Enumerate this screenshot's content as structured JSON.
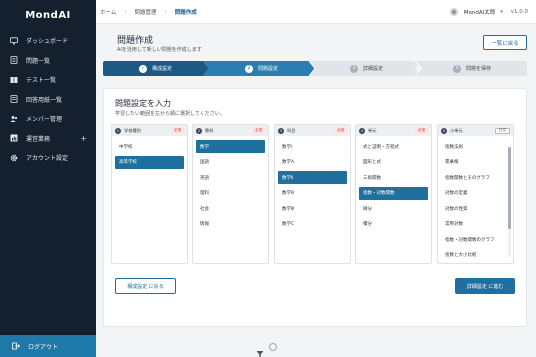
{
  "app": {
    "logo": "MondAI"
  },
  "sidebar": {
    "items": [
      {
        "label": "ダッシュボード",
        "icon": "monitor-icon"
      },
      {
        "label": "問題一覧",
        "icon": "list-icon"
      },
      {
        "label": "テスト一覧",
        "icon": "book-icon"
      },
      {
        "label": "回答用紙一覧",
        "icon": "answer-sheet-icon"
      },
      {
        "label": "メンバー管理",
        "icon": "members-icon"
      },
      {
        "label": "運営業務",
        "icon": "chart-icon",
        "expandable": true
      },
      {
        "label": "アカウント設定",
        "icon": "gear-icon"
      }
    ],
    "logout_label": "ログアウト"
  },
  "header": {
    "breadcrumbs": [
      "ホーム",
      "問題管理",
      "問題作成"
    ],
    "user_name": "MondAI太郎",
    "version": "v1.0.0"
  },
  "page": {
    "title": "問題作成",
    "subtitle": "AIを活用して新しい問題を作成します",
    "list_button": "一覧に戻る"
  },
  "stepper": {
    "steps": [
      {
        "num": "✓",
        "label": "構成設定",
        "state": "done"
      },
      {
        "num": "2",
        "label": "問題設定",
        "state": "active"
      },
      {
        "num": "3",
        "label": "詳細設定",
        "state": "todo"
      },
      {
        "num": "4",
        "label": "問題を保存",
        "state": "todo"
      }
    ],
    "colors": {
      "done": "#1c5a86",
      "active": "#2a7fb0",
      "todo": "#e1e5e9"
    }
  },
  "card": {
    "title": "問題設定を入力",
    "subtitle": "学習したい範囲を左から順に選択してください。",
    "columns": [
      {
        "num": "1",
        "label": "学校種別",
        "badge": "必須",
        "badge_type": "req",
        "options": [
          {
            "label": "中学校"
          },
          {
            "label": "高等学校",
            "selected": true
          }
        ]
      },
      {
        "num": "2",
        "label": "教科",
        "badge": "必須",
        "badge_type": "req",
        "options": [
          {
            "label": "数学",
            "selected": true
          },
          {
            "label": "国語"
          },
          {
            "label": "英語"
          },
          {
            "label": "理科"
          },
          {
            "label": "社会"
          },
          {
            "label": "情報"
          }
        ]
      },
      {
        "num": "3",
        "label": "科目",
        "badge": "必須",
        "badge_type": "req",
        "options": [
          {
            "label": "数学Ⅰ"
          },
          {
            "label": "数学A"
          },
          {
            "label": "数学Ⅱ",
            "selected": true
          },
          {
            "label": "数学B"
          },
          {
            "label": "数学Ⅲ"
          },
          {
            "label": "数学C"
          }
        ]
      },
      {
        "num": "4",
        "label": "単元",
        "badge": "必須",
        "badge_type": "req",
        "options": [
          {
            "label": "式と証明・方程式"
          },
          {
            "label": "図形と式"
          },
          {
            "label": "三角関数"
          },
          {
            "label": "指数・対数関数",
            "selected": true
          },
          {
            "label": "微分"
          },
          {
            "label": "積分"
          }
        ]
      },
      {
        "num": "5",
        "label": "小単元",
        "badge": "任意",
        "badge_type": "opt",
        "scrollable": true,
        "options": [
          {
            "label": "指数法則"
          },
          {
            "label": "累乗根"
          },
          {
            "label": "指数関数とそのグラフ"
          },
          {
            "label": "対数の定義"
          },
          {
            "label": "対数の性質"
          },
          {
            "label": "常用対数"
          },
          {
            "label": "指数・対数関数のグラフ"
          },
          {
            "label": "指数と大小比較"
          }
        ]
      }
    ],
    "back_button": "構成設定 に戻る",
    "next_button": "詳細設定 に進む"
  }
}
